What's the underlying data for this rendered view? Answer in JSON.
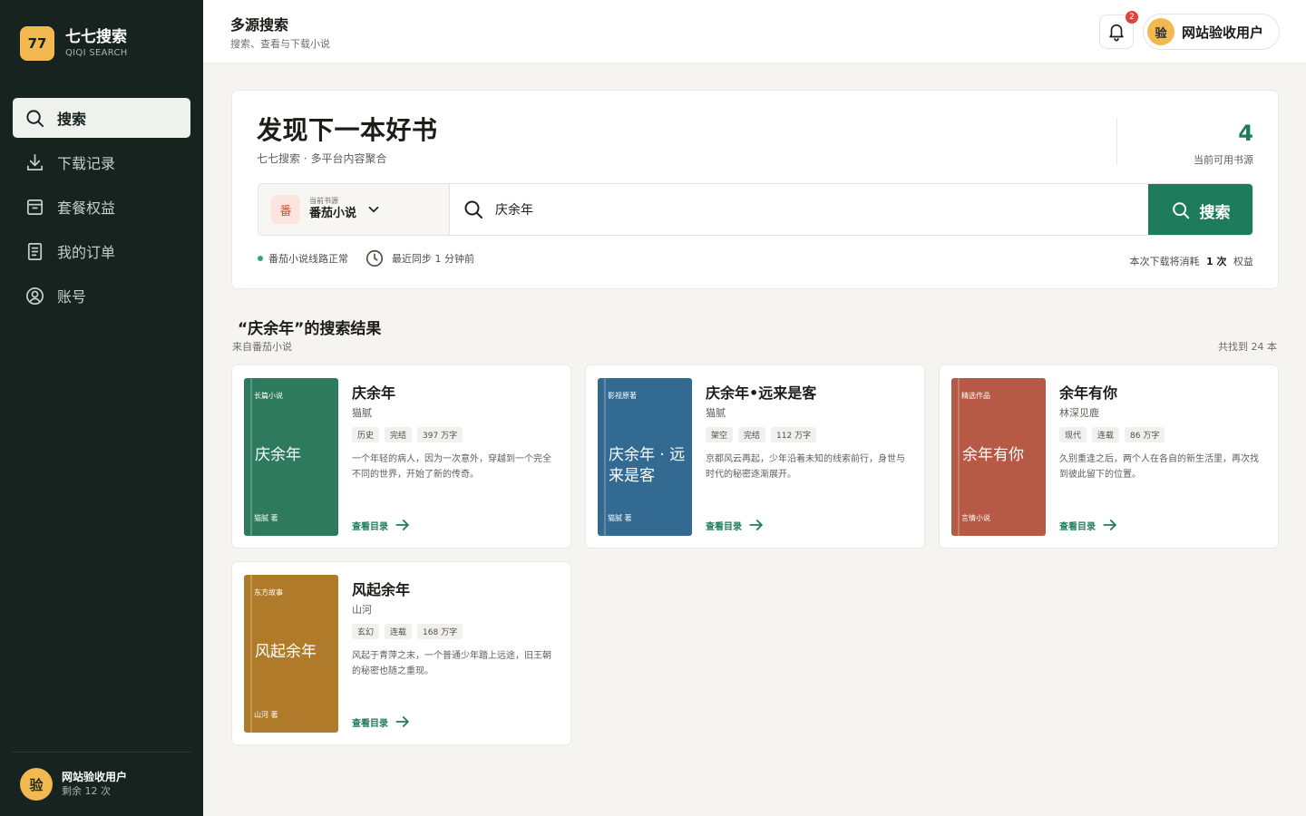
{
  "brand": {
    "logo": "77",
    "name": "七七搜索",
    "sub": "QIQI SEARCH"
  },
  "nav": [
    {
      "label": "搜索",
      "icon": "search-icon"
    },
    {
      "label": "下载记录",
      "icon": "download-icon"
    },
    {
      "label": "套餐权益",
      "icon": "package-icon"
    },
    {
      "label": "我的订单",
      "icon": "order-icon"
    },
    {
      "label": "账号",
      "icon": "account-icon"
    }
  ],
  "sidebar_user": {
    "avatar": "验",
    "name": "网站验收用户",
    "quota": "剩余 12 次"
  },
  "topbar": {
    "title": "多源搜索",
    "subtitle": "搜索、查看与下载小说",
    "notifications": "2",
    "user_avatar": "验",
    "user_name": "网站验收用户"
  },
  "hero": {
    "title": "发现下一本好书",
    "subtitle": "七七搜索 · 多平台内容聚合",
    "source_count": "4",
    "source_count_label": "当前可用书源"
  },
  "search": {
    "source_caption": "当前书源",
    "source_badge": "番",
    "source_name": "番茄小说",
    "query": "庆余年",
    "button": "搜索"
  },
  "status": {
    "route": "番茄小说线路正常",
    "sync": "最近同步 1 分钟前",
    "cost_prefix": "本次下载将消耗",
    "cost_value": "1 次",
    "cost_suffix": "权益"
  },
  "results": {
    "title": "“庆余年”的搜索结果",
    "source": "来自番茄小说",
    "count": "共找到 24 本"
  },
  "books": [
    {
      "title": "庆余年",
      "author": "猫腻",
      "tags": [
        "历史",
        "完结",
        "397 万字"
      ],
      "desc": "一个年轻的病人，因为一次意外，穿越到一个完全不同的世界，开始了新的传奇。",
      "cover_top": "长篇小说",
      "cover_title": "庆余年",
      "cover_bottom": "猫腻 著",
      "cover_color": "#2e7a5e",
      "link": "查看目录"
    },
    {
      "title": "庆余年•远来是客",
      "author": "猫腻",
      "tags": [
        "架空",
        "完结",
        "112 万字"
      ],
      "desc": "京都风云再起，少年沿着未知的线索前行，身世与时代的秘密逐渐展开。",
      "cover_top": "影视原著",
      "cover_title": "庆余年 · 远来是客",
      "cover_bottom": "猫腻 著",
      "cover_color": "#336a91",
      "link": "查看目录"
    },
    {
      "title": "余年有你",
      "author": "林深见鹿",
      "tags": [
        "现代",
        "连载",
        "86 万字"
      ],
      "desc": "久别重逢之后，两个人在各自的新生活里，再次找到彼此留下的位置。",
      "cover_top": "精选作品",
      "cover_title": "余年有你",
      "cover_bottom": "言情小说",
      "cover_color": "#b65a45",
      "link": "查看目录"
    },
    {
      "title": "风起余年",
      "author": "山河",
      "tags": [
        "玄幻",
        "连载",
        "168 万字"
      ],
      "desc": "风起于青萍之末，一个普通少年踏上远途，旧王朝的秘密也随之重现。",
      "cover_top": "东方故事",
      "cover_title": "风起余年",
      "cover_bottom": "山河 著",
      "cover_color": "#b07a2b",
      "link": "查看目录"
    }
  ],
  "colors": {
    "sidebar": "#16231e",
    "accent": "#1e7b5c",
    "logo": "#f2b950"
  }
}
